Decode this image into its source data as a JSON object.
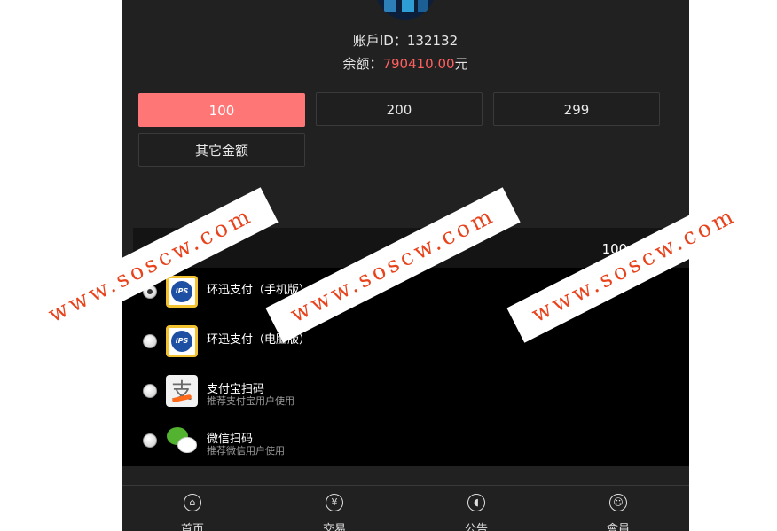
{
  "account": {
    "id_label": "账戶ID：",
    "id_value": "132132",
    "balance_label": "余额：",
    "balance_value": "790410.00",
    "balance_unit": "元"
  },
  "amounts": {
    "options": [
      "100",
      "200",
      "299"
    ],
    "selected": "100",
    "other_label": "其它金额"
  },
  "summary": {
    "amount_text": "100 元"
  },
  "payments": [
    {
      "title": "环迅支付（手机版）",
      "subtitle": "",
      "icon": "ips-icon",
      "selected": true
    },
    {
      "title": "环迅支付（电脑版）",
      "subtitle": "",
      "icon": "ips-icon",
      "selected": false
    },
    {
      "title": "支付宝扫码",
      "subtitle": "推荐支付宝用户使用",
      "icon": "alipay-icon",
      "selected": false
    },
    {
      "title": "微信扫码",
      "subtitle": "推荐微信用户使用",
      "icon": "wechat-icon",
      "selected": false
    }
  ],
  "icons": {
    "ips_text": "IPS",
    "alipay_glyph": "支"
  },
  "nav": {
    "items": [
      {
        "label": "首页",
        "icon": "home-icon",
        "glyph": "⌂"
      },
      {
        "label": "交易",
        "icon": "yen-icon",
        "glyph": "¥"
      },
      {
        "label": "公告",
        "icon": "speaker-icon",
        "glyph": "◖"
      },
      {
        "label": "會員",
        "icon": "user-icon",
        "glyph": "☺"
      }
    ]
  },
  "watermark": {
    "text": "www.soscw.com"
  },
  "colors": {
    "background": "#212121",
    "accent": "#ff7676",
    "balance": "#ff5f5f",
    "list_background": "#000000",
    "watermark_text": "#e8431c"
  }
}
